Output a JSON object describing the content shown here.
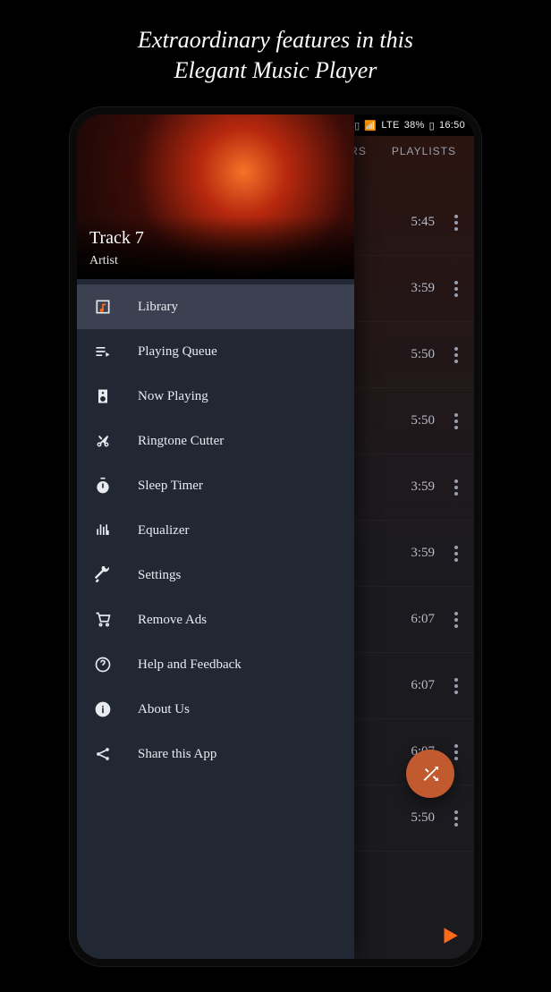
{
  "promo": {
    "line1": "Extraordinary features in this",
    "line2": "Elegant Music Player"
  },
  "statusbar": {
    "network": "LTE",
    "battery": "38%",
    "time": "16:50"
  },
  "tabs": [
    "RS",
    "PLAYLISTS"
  ],
  "now_playing": {
    "track": "Track 7",
    "artist": "Artist"
  },
  "menu": [
    {
      "id": "library",
      "label": "Library",
      "icon": "music-note-icon",
      "active": true
    },
    {
      "id": "queue",
      "label": "Playing Queue",
      "icon": "queue-icon",
      "active": false
    },
    {
      "id": "now",
      "label": "Now Playing",
      "icon": "speaker-icon",
      "active": false
    },
    {
      "id": "ringtone",
      "label": "Ringtone Cutter",
      "icon": "scissors-icon",
      "active": false
    },
    {
      "id": "sleep",
      "label": "Sleep Timer",
      "icon": "timer-icon",
      "active": false
    },
    {
      "id": "eq",
      "label": "Equalizer",
      "icon": "equalizer-icon",
      "active": false
    },
    {
      "id": "settings",
      "label": "Settings",
      "icon": "wrench-icon",
      "active": false
    },
    {
      "id": "ads",
      "label": "Remove Ads",
      "icon": "cart-icon",
      "active": false
    },
    {
      "id": "help",
      "label": "Help and Feedback",
      "icon": "help-icon",
      "active": false
    },
    {
      "id": "about",
      "label": "About Us",
      "icon": "info-icon",
      "active": false
    },
    {
      "id": "share",
      "label": "Share this App",
      "icon": "share-icon",
      "active": false
    }
  ],
  "tracks": [
    {
      "duration": "5:45"
    },
    {
      "duration": "3:59"
    },
    {
      "duration": "5:50"
    },
    {
      "duration": "5:50"
    },
    {
      "duration": "3:59"
    },
    {
      "duration": "3:59"
    },
    {
      "duration": "6:07"
    },
    {
      "duration": "6:07"
    },
    {
      "duration": "6:07"
    },
    {
      "duration": "5:50"
    }
  ]
}
